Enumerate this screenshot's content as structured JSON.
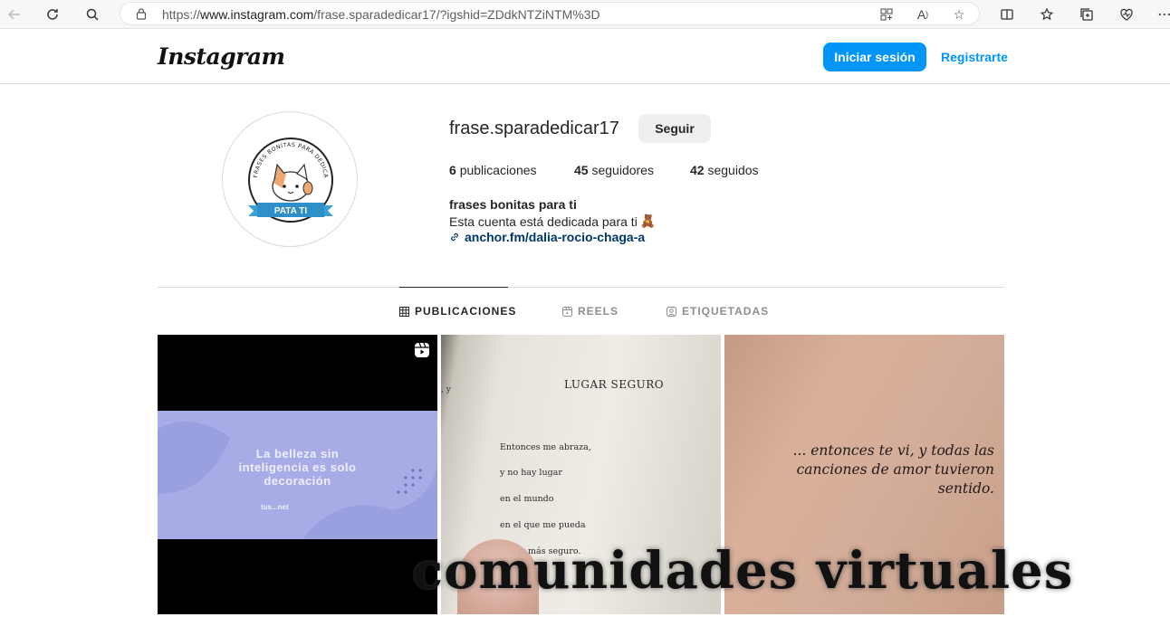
{
  "browser": {
    "url_prefix": "https://",
    "url_host": "www.instagram.com",
    "url_path": "/frase.sparadedicar17/?igshid=ZDdkNTZiNTM%3D"
  },
  "header": {
    "logo": "Instagram",
    "login_label": "Iniciar sesión",
    "register_label": "Registrarte"
  },
  "profile": {
    "avatar_text_top": "FRASES BONITAS PARA DEDICAR",
    "avatar_ribbon": "PATA TI",
    "username": "frase.sparadedicar17",
    "follow_label": "Seguir",
    "stats": {
      "posts_count": "6",
      "posts_label": "publicaciones",
      "followers_count": "45",
      "followers_label": "seguidores",
      "following_count": "42",
      "following_label": "seguidos"
    },
    "bio_name": "frases bonitas para ti",
    "bio_text": "Esta cuenta está dedicada para ti",
    "bio_emoji": "🧸",
    "link": "anchor.fm/dalia-rocio-chaga-a"
  },
  "tabs": [
    {
      "label": "PUBLICACIONES",
      "icon": "grid-icon"
    },
    {
      "label": "REELS",
      "icon": "reels-icon"
    },
    {
      "label": "ETIQUETADAS",
      "icon": "tagged-icon"
    }
  ],
  "posts": {
    "p1_text": "La belleza sin inteligencia es solo decoración",
    "p1_footer": "tus...net",
    "p2_title": "LUGAR SEGURO",
    "p2_side": ", y",
    "p2_lines": [
      "Entonces me abraza,",
      "y no hay lugar",
      "en el mundo",
      "en el que me pueda",
      "sentir más seguro."
    ],
    "p3_quote": "... entonces te vi, y todas las canciones de amor tuvieron sentido."
  },
  "overlay": {
    "watermark": "comunidades virtuales"
  },
  "colors": {
    "primary_button": "#0095f6",
    "link_text": "#00376b",
    "border": "#dbdbdb"
  }
}
